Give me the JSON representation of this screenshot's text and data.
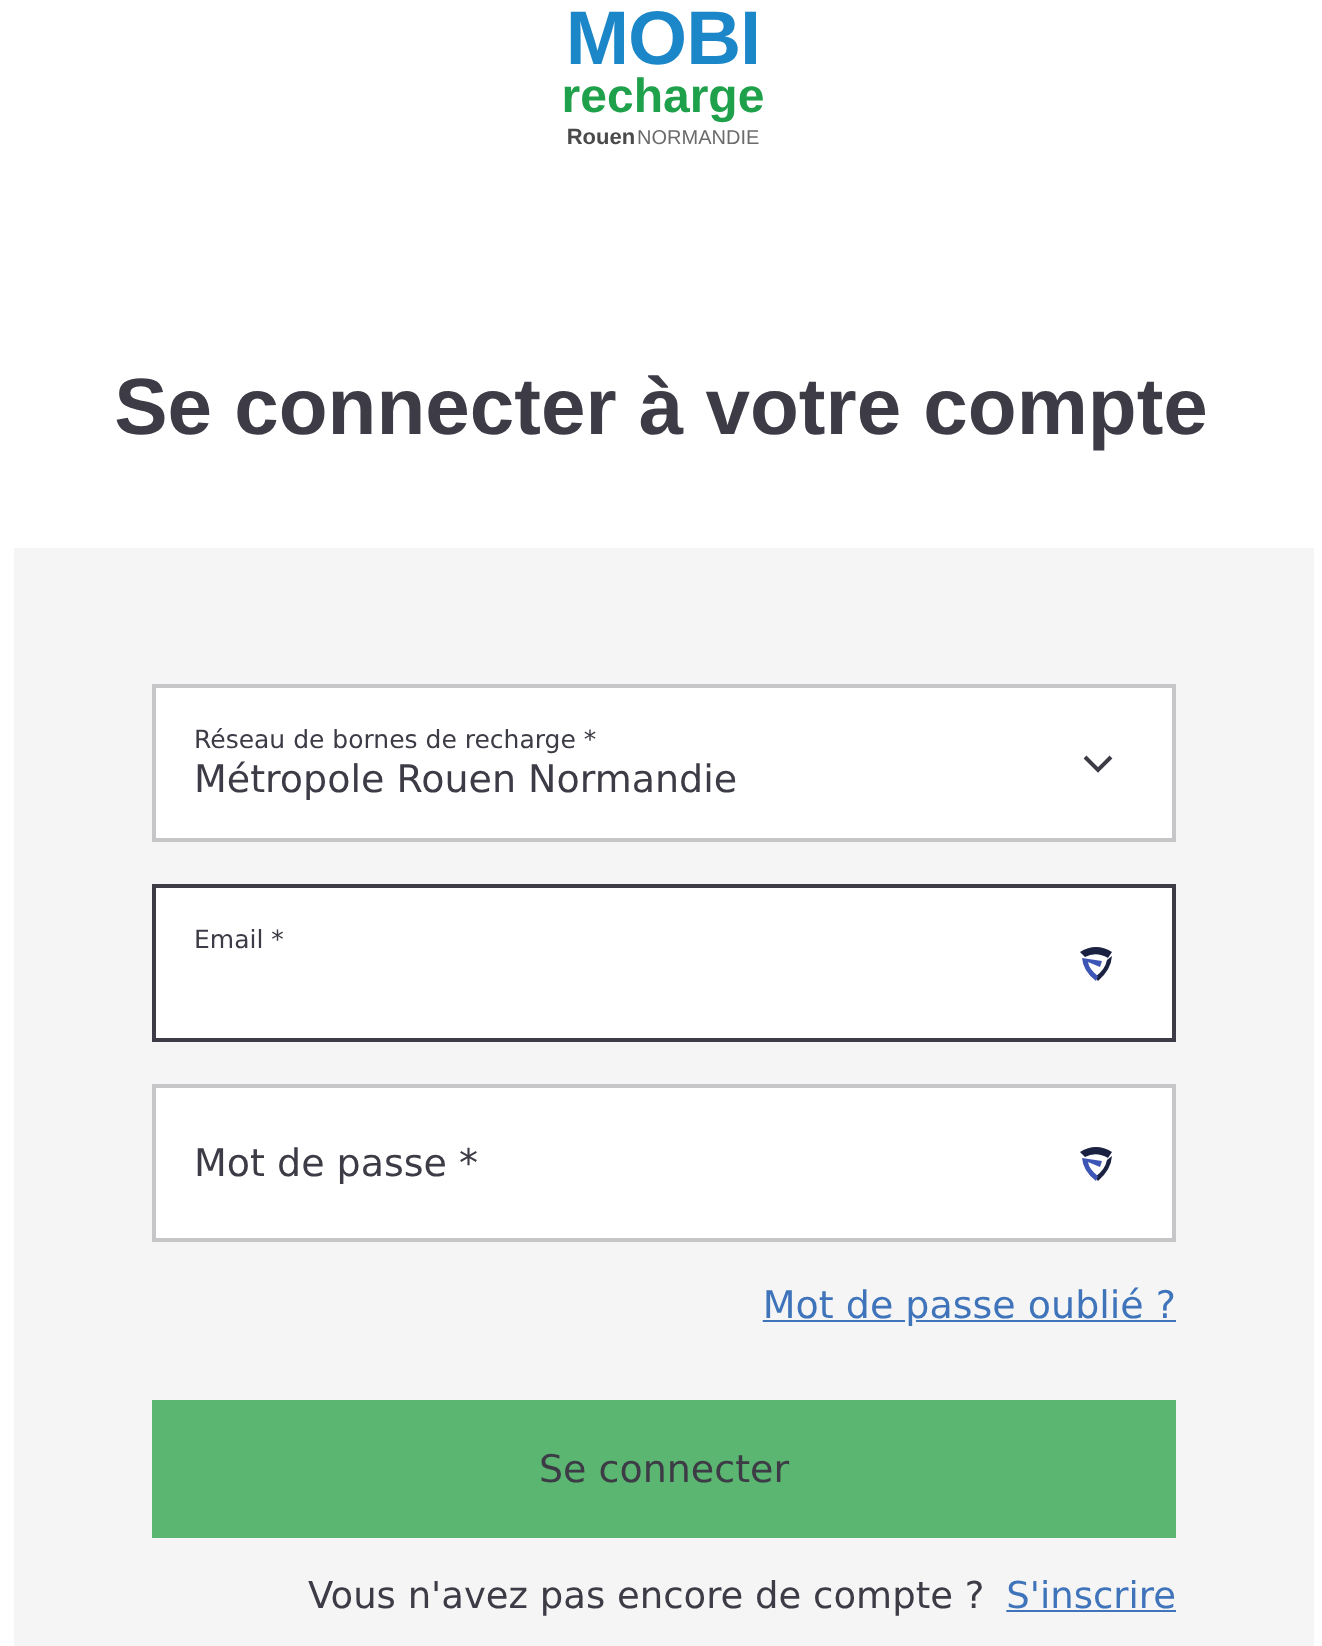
{
  "logo": {
    "brand": "MOBI",
    "tagline": "recharge",
    "city": "Rouen",
    "region": "NORMANDIE"
  },
  "title": "Se connecter à votre compte",
  "form": {
    "fields": [
      {
        "kind": "select",
        "label": "Réseau de bornes de recharge *",
        "value": "Métropole Rouen Normandie",
        "focused": false
      },
      {
        "kind": "email",
        "label": "Email *",
        "focused": true
      },
      {
        "kind": "password",
        "label": "Mot de passe *",
        "focused": false
      }
    ],
    "forgot_link": "Mot de passe oublié ?",
    "submit_button": "Se connecter",
    "signup_prompt": "Vous n'avez pas encore de compte ?",
    "signup_link": "S'inscrire"
  }
}
